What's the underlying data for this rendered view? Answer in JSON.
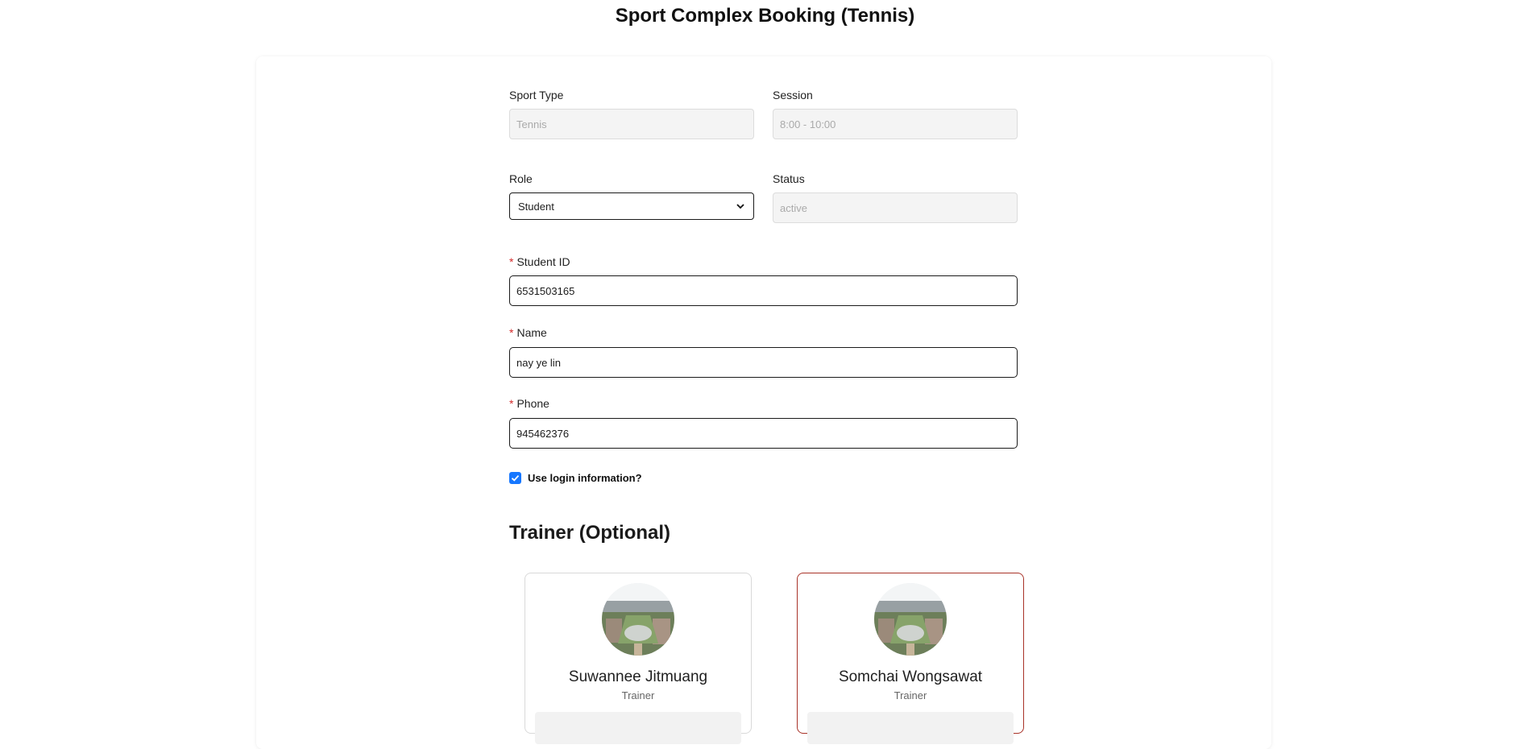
{
  "page": {
    "title": "Sport Complex Booking (Tennis)"
  },
  "form": {
    "sport_type": {
      "label": "Sport Type",
      "value": "Tennis"
    },
    "session": {
      "label": "Session",
      "value": "8:00 - 10:00"
    },
    "role": {
      "label": "Role",
      "value": "Student"
    },
    "status": {
      "label": "Status",
      "value": "active"
    },
    "student_id": {
      "label": "Student ID",
      "required_mark": "*",
      "value": "6531503165"
    },
    "name": {
      "label": "Name",
      "required_mark": "*",
      "value": "nay ye lin"
    },
    "phone": {
      "label": "Phone",
      "required_mark": "*",
      "value": "945462376"
    },
    "use_login": {
      "label": "Use login information?",
      "checked": true
    }
  },
  "trainers": {
    "title": "Trainer (Optional)",
    "items": [
      {
        "name": "Suwannee Jitmuang",
        "role": "Trainer",
        "selected": false
      },
      {
        "name": "Somchai Wongsawat",
        "role": "Trainer",
        "selected": true
      }
    ]
  },
  "colors": {
    "accent": "#1677ff",
    "required": "#d42b2b",
    "selected_border": "#a83228"
  }
}
